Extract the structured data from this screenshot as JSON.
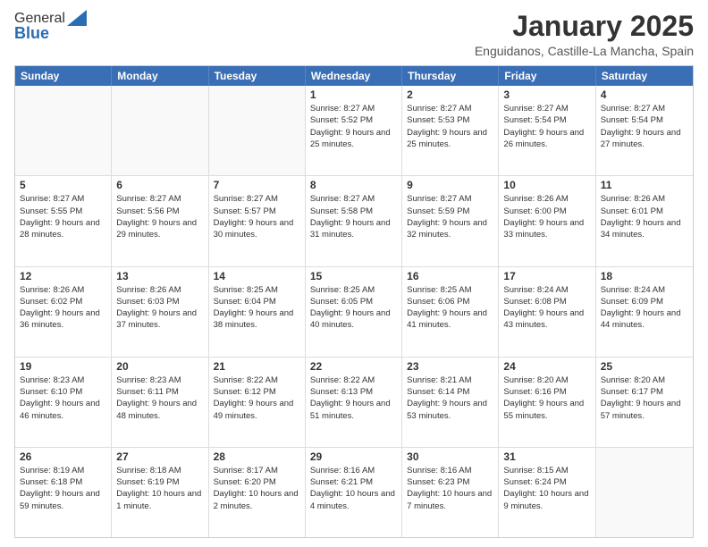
{
  "logo": {
    "general": "General",
    "blue": "Blue"
  },
  "header": {
    "month": "January 2025",
    "location": "Enguidanos, Castille-La Mancha, Spain"
  },
  "days": [
    "Sunday",
    "Monday",
    "Tuesday",
    "Wednesday",
    "Thursday",
    "Friday",
    "Saturday"
  ],
  "weeks": [
    [
      {
        "date": "",
        "empty": true
      },
      {
        "date": "",
        "empty": true
      },
      {
        "date": "",
        "empty": true
      },
      {
        "date": "1",
        "sunrise": "8:27 AM",
        "sunset": "5:52 PM",
        "daylight": "9 hours and 25 minutes."
      },
      {
        "date": "2",
        "sunrise": "8:27 AM",
        "sunset": "5:53 PM",
        "daylight": "9 hours and 25 minutes."
      },
      {
        "date": "3",
        "sunrise": "8:27 AM",
        "sunset": "5:54 PM",
        "daylight": "9 hours and 26 minutes."
      },
      {
        "date": "4",
        "sunrise": "8:27 AM",
        "sunset": "5:54 PM",
        "daylight": "9 hours and 27 minutes."
      }
    ],
    [
      {
        "date": "5",
        "sunrise": "8:27 AM",
        "sunset": "5:55 PM",
        "daylight": "9 hours and 28 minutes."
      },
      {
        "date": "6",
        "sunrise": "8:27 AM",
        "sunset": "5:56 PM",
        "daylight": "9 hours and 29 minutes."
      },
      {
        "date": "7",
        "sunrise": "8:27 AM",
        "sunset": "5:57 PM",
        "daylight": "9 hours and 30 minutes."
      },
      {
        "date": "8",
        "sunrise": "8:27 AM",
        "sunset": "5:58 PM",
        "daylight": "9 hours and 31 minutes."
      },
      {
        "date": "9",
        "sunrise": "8:27 AM",
        "sunset": "5:59 PM",
        "daylight": "9 hours and 32 minutes."
      },
      {
        "date": "10",
        "sunrise": "8:26 AM",
        "sunset": "6:00 PM",
        "daylight": "9 hours and 33 minutes."
      },
      {
        "date": "11",
        "sunrise": "8:26 AM",
        "sunset": "6:01 PM",
        "daylight": "9 hours and 34 minutes."
      }
    ],
    [
      {
        "date": "12",
        "sunrise": "8:26 AM",
        "sunset": "6:02 PM",
        "daylight": "9 hours and 36 minutes."
      },
      {
        "date": "13",
        "sunrise": "8:26 AM",
        "sunset": "6:03 PM",
        "daylight": "9 hours and 37 minutes."
      },
      {
        "date": "14",
        "sunrise": "8:25 AM",
        "sunset": "6:04 PM",
        "daylight": "9 hours and 38 minutes."
      },
      {
        "date": "15",
        "sunrise": "8:25 AM",
        "sunset": "6:05 PM",
        "daylight": "9 hours and 40 minutes."
      },
      {
        "date": "16",
        "sunrise": "8:25 AM",
        "sunset": "6:06 PM",
        "daylight": "9 hours and 41 minutes."
      },
      {
        "date": "17",
        "sunrise": "8:24 AM",
        "sunset": "6:08 PM",
        "daylight": "9 hours and 43 minutes."
      },
      {
        "date": "18",
        "sunrise": "8:24 AM",
        "sunset": "6:09 PM",
        "daylight": "9 hours and 44 minutes."
      }
    ],
    [
      {
        "date": "19",
        "sunrise": "8:23 AM",
        "sunset": "6:10 PM",
        "daylight": "9 hours and 46 minutes."
      },
      {
        "date": "20",
        "sunrise": "8:23 AM",
        "sunset": "6:11 PM",
        "daylight": "9 hours and 48 minutes."
      },
      {
        "date": "21",
        "sunrise": "8:22 AM",
        "sunset": "6:12 PM",
        "daylight": "9 hours and 49 minutes."
      },
      {
        "date": "22",
        "sunrise": "8:22 AM",
        "sunset": "6:13 PM",
        "daylight": "9 hours and 51 minutes."
      },
      {
        "date": "23",
        "sunrise": "8:21 AM",
        "sunset": "6:14 PM",
        "daylight": "9 hours and 53 minutes."
      },
      {
        "date": "24",
        "sunrise": "8:20 AM",
        "sunset": "6:16 PM",
        "daylight": "9 hours and 55 minutes."
      },
      {
        "date": "25",
        "sunrise": "8:20 AM",
        "sunset": "6:17 PM",
        "daylight": "9 hours and 57 minutes."
      }
    ],
    [
      {
        "date": "26",
        "sunrise": "8:19 AM",
        "sunset": "6:18 PM",
        "daylight": "9 hours and 59 minutes."
      },
      {
        "date": "27",
        "sunrise": "8:18 AM",
        "sunset": "6:19 PM",
        "daylight": "10 hours and 1 minute."
      },
      {
        "date": "28",
        "sunrise": "8:17 AM",
        "sunset": "6:20 PM",
        "daylight": "10 hours and 2 minutes."
      },
      {
        "date": "29",
        "sunrise": "8:16 AM",
        "sunset": "6:21 PM",
        "daylight": "10 hours and 4 minutes."
      },
      {
        "date": "30",
        "sunrise": "8:16 AM",
        "sunset": "6:23 PM",
        "daylight": "10 hours and 7 minutes."
      },
      {
        "date": "31",
        "sunrise": "8:15 AM",
        "sunset": "6:24 PM",
        "daylight": "10 hours and 9 minutes."
      },
      {
        "date": "",
        "empty": true
      }
    ]
  ]
}
